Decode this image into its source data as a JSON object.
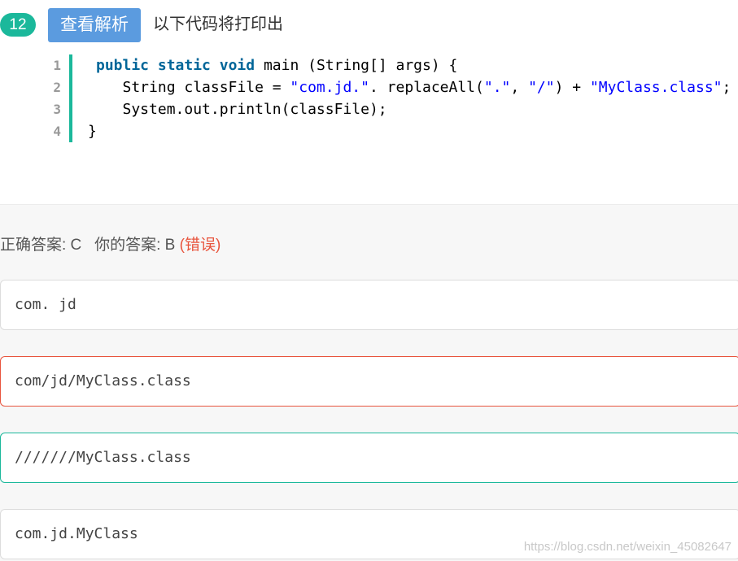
{
  "question": {
    "number": "12",
    "view_analysis_label": "查看解析",
    "prompt": "以下代码将打印出"
  },
  "code": {
    "line_numbers": [
      "1",
      "2",
      "3",
      "4"
    ],
    "lines": [
      "public static void main (String[] args) {",
      "   String classFile = \"com.jd.\". replaceAll(\".\", \"/\") + \"MyClass.class\";",
      "   System.out.println(classFile);",
      "}"
    ]
  },
  "result": {
    "correct_label": "正确答案: C",
    "your_label": "你的答案: B",
    "status": "(错误)"
  },
  "options": [
    {
      "text": "com. jd",
      "state": "normal"
    },
    {
      "text": "com/jd/MyClass.class",
      "state": "selected-wrong"
    },
    {
      "text": "///////MyClass.class",
      "state": "correct"
    },
    {
      "text": "com.jd.MyClass",
      "state": "normal"
    }
  ],
  "watermark": "https://blog.csdn.net/weixin_45082647",
  "colors": {
    "accent_green": "#1bb89b",
    "button_blue": "#5b9bdf",
    "error_red": "#e8553e",
    "keyword": "#006699",
    "string": "#0000ff"
  }
}
